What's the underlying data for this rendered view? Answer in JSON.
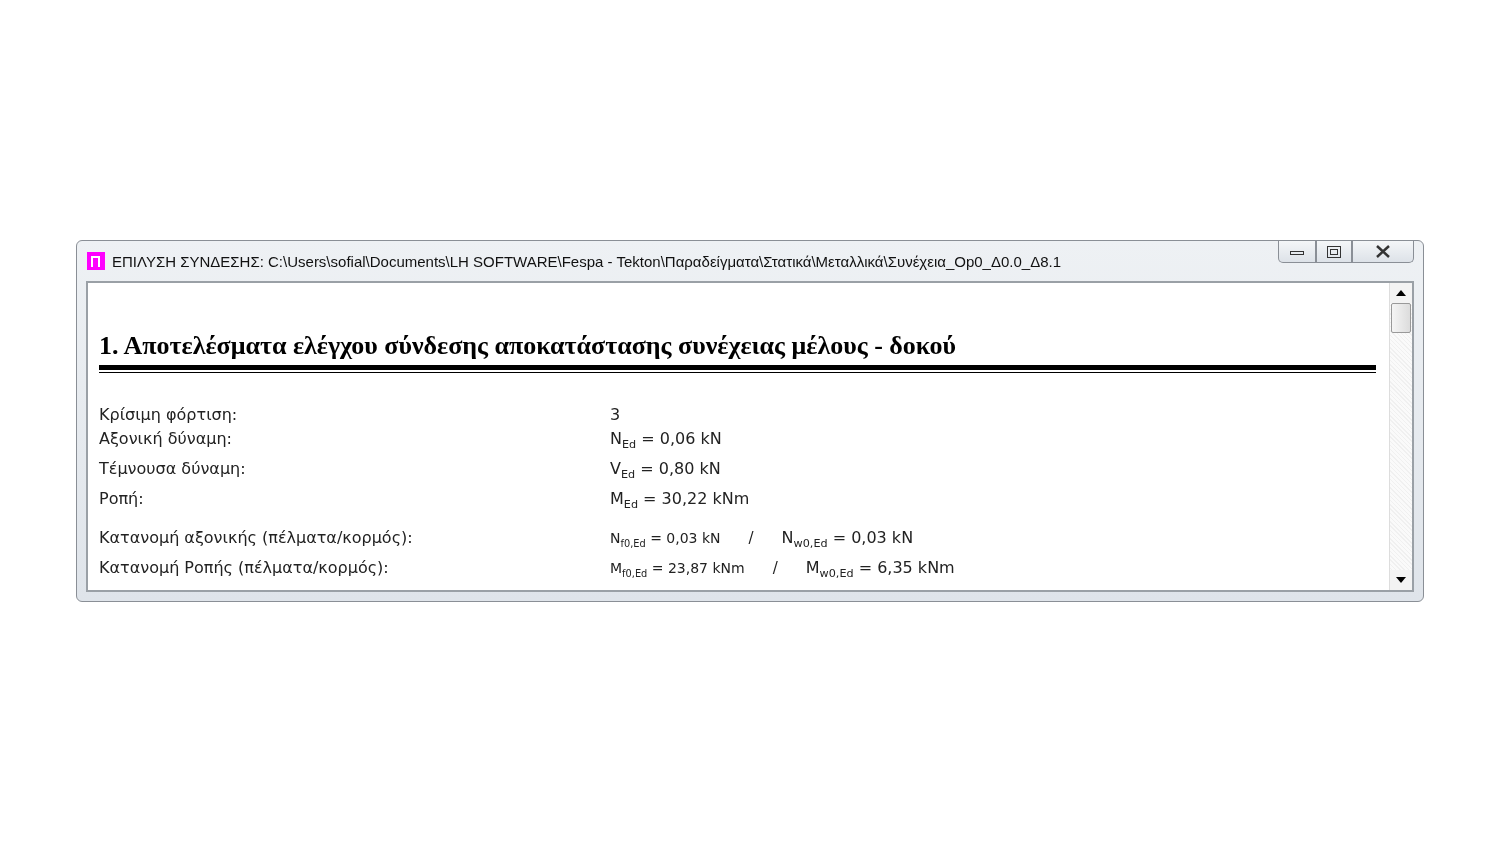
{
  "window": {
    "title": "ΕΠΙΛΥΣΗ ΣΥΝΔΕΣΗΣ: C:\\Users\\sofial\\Documents\\LH SOFTWARE\\Fespa - Tekton\\Παραδείγματα\\Στατικά\\Μεταλλικά\\Συνέχεια_Op0_Δ0.0_Δ8.1"
  },
  "report": {
    "heading": "1. Αποτελέσματα ελέγχου σύνδεσης αποκατάστασης συνέχειας μέλους - δοκού",
    "groups": [
      {
        "rows": [
          {
            "kind": "single",
            "label": "Κρίσιμη φόρτιση:",
            "value": "3"
          },
          {
            "kind": "single",
            "label": "Αξονική δύναμη:",
            "value": "N$_{Ed}$ = 0,06 kN"
          },
          {
            "kind": "single",
            "label": "Τέμνουσα δύναμη:",
            "value": "V$_{Ed}$ = 0,80 kN"
          },
          {
            "kind": "single",
            "label": "Ροπή:",
            "value": "M$_{Ed}$ = 30,22 kNm"
          }
        ]
      },
      {
        "rows": [
          {
            "kind": "split",
            "label": "Κατανομή αξονικής (πέλματα/κορμός):",
            "first": "N$_{f0,Ed}$ = 0,03 kN",
            "separator": "/",
            "second": "N$_{w0,Ed}$ = 0,03 kN"
          },
          {
            "kind": "split",
            "label": "Κατανομή Ροπής (πέλματα/κορμός):",
            "first": "M$_{f0,Ed}$ = 23,87 kNm",
            "separator": "/",
            "second": "M$_{w0,Ed}$ = 6,35 kNm"
          }
        ]
      }
    ]
  }
}
